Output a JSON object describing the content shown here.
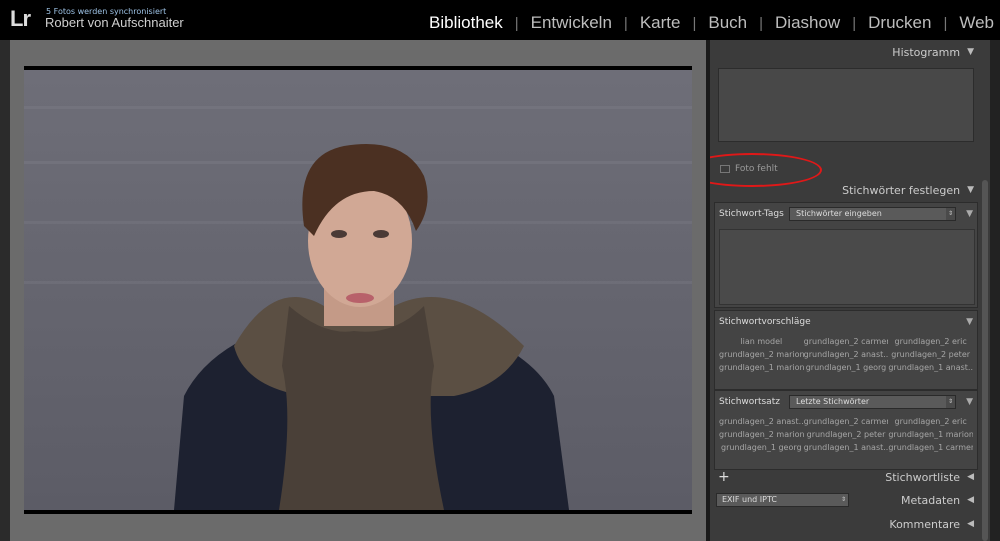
{
  "app": {
    "logo": "Lr",
    "sync_status": "5 Fotos werden synchronisiert",
    "user_name": "Robert von Aufschnaiter"
  },
  "modules": [
    {
      "label": "Bibliothek",
      "active": true
    },
    {
      "label": "Entwickeln",
      "active": false
    },
    {
      "label": "Karte",
      "active": false
    },
    {
      "label": "Buch",
      "active": false
    },
    {
      "label": "Diashow",
      "active": false
    },
    {
      "label": "Drucken",
      "active": false
    },
    {
      "label": "Web",
      "active": false
    }
  ],
  "histogram": {
    "title": "Histogramm",
    "photo_missing": "Foto fehlt"
  },
  "keywording": {
    "title": "Stichwörter festlegen",
    "tags_label": "Stichwort-Tags",
    "tags_select": "Stichwörter eingeben",
    "suggestions_label": "Stichwortvorschläge",
    "suggestions": [
      "lian model",
      "grundlagen_2 carmen",
      "grundlagen_2 eric",
      "grundlagen_2 marion",
      "grundlagen_2 anast...",
      "grundlagen_2 peter",
      "grundlagen_1 marion",
      "grundlagen_1 georg",
      "grundlagen_1 anast..."
    ],
    "set_label": "Stichwortsatz",
    "set_select": "Letzte Stichwörter",
    "set_keywords": [
      "grundlagen_2 anast...",
      "grundlagen_2 carmen",
      "grundlagen_2 eric",
      "grundlagen_2 marion",
      "grundlagen_2 peter",
      "grundlagen_1 marion",
      "grundlagen_1 georg",
      "grundlagen_1 anast...",
      "grundlagen_1 carmen"
    ]
  },
  "keyword_list": {
    "plus": "+",
    "title": "Stichwortliste"
  },
  "metadata": {
    "preset": "EXIF und IPTC",
    "title": "Metadaten"
  },
  "comments": {
    "title": "Kommentare"
  },
  "colors": {
    "accent_red": "#e01818",
    "sync_blue": "#9ec3e6"
  }
}
